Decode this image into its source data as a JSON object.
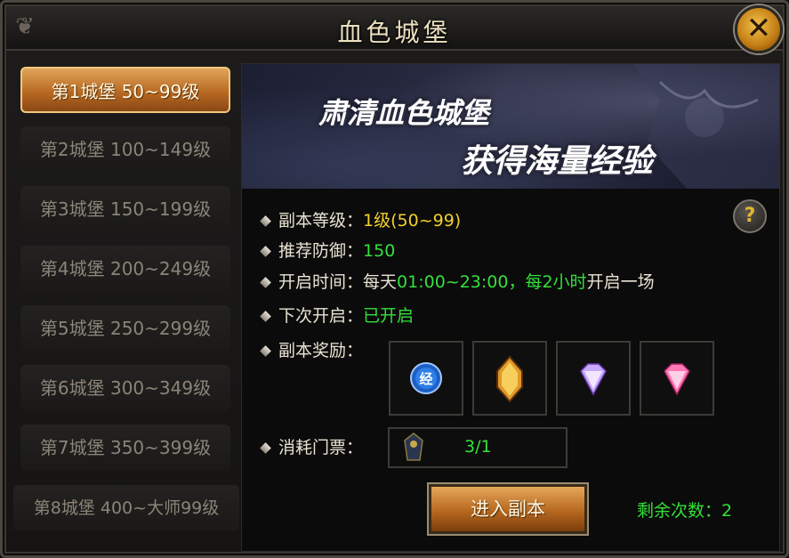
{
  "window": {
    "title": "血色城堡"
  },
  "tabs": [
    {
      "label": "第1城堡 50~99级",
      "active": true
    },
    {
      "label": "第2城堡 100~149级",
      "active": false
    },
    {
      "label": "第3城堡 150~199级",
      "active": false
    },
    {
      "label": "第4城堡 200~249级",
      "active": false
    },
    {
      "label": "第5城堡 250~299级",
      "active": false
    },
    {
      "label": "第6城堡 300~349级",
      "active": false
    },
    {
      "label": "第7城堡 350~399级",
      "active": false
    },
    {
      "label": "第8城堡 400~大师99级",
      "active": false
    }
  ],
  "banner": {
    "line1": "肃清血色城堡",
    "line2": "获得海量经验"
  },
  "info": {
    "level_label": "副本等级：",
    "level_value": "1级(50~99)",
    "defense_label": "推荐防御：",
    "defense_value": "150",
    "time_label": "开启时间：",
    "time_prefix": "每天",
    "time_range": "01:00~23:00，",
    "time_interval": "每2小时",
    "time_suffix": "开启一场",
    "next_label": "下次开启：",
    "next_value": "已开启",
    "reward_label": "副本奖励：",
    "ticket_label": "消耗门票：",
    "ticket_count": "3/1"
  },
  "rewards": [
    {
      "icon": "exp-orb-icon",
      "glyph": "经"
    },
    {
      "icon": "gold-crystal-icon",
      "glyph": ""
    },
    {
      "icon": "purple-gem-icon",
      "glyph": ""
    },
    {
      "icon": "pink-gem-icon",
      "glyph": ""
    }
  ],
  "actions": {
    "enter_label": "进入副本",
    "remaining_label": "剩余次数：",
    "remaining_count": "2"
  },
  "colors": {
    "accent": "#c27b14",
    "green": "#33e13a",
    "yellow": "#f2d02c"
  }
}
